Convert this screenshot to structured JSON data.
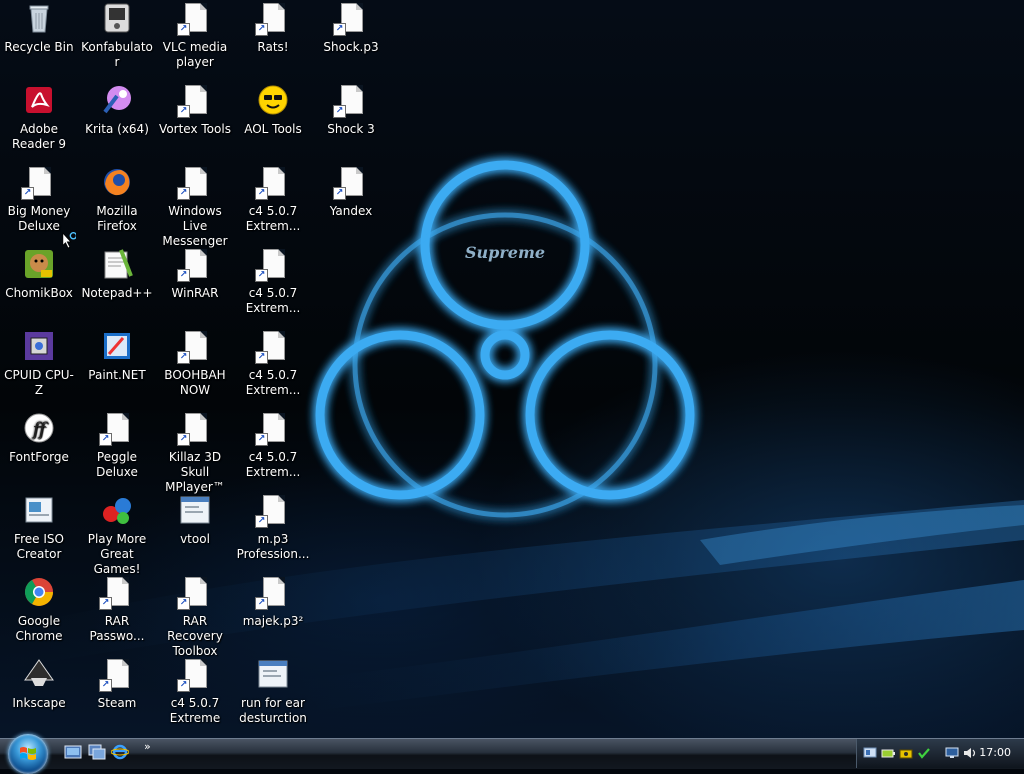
{
  "desktop": {
    "icons": [
      {
        "label": "Recycle Bin",
        "icon": "recycle-bin-icon"
      },
      {
        "label": "Adobe Reader 9",
        "icon": "adobe-reader-icon"
      },
      {
        "label": "Big Money Deluxe",
        "icon": "shortcut-document-icon"
      },
      {
        "label": "ChomikBox",
        "icon": "chomikbox-icon"
      },
      {
        "label": "CPUID CPU-Z",
        "icon": "cpuz-icon"
      },
      {
        "label": "FontForge",
        "icon": "fontforge-icon"
      },
      {
        "label": "Free ISO Creator",
        "icon": "iso-creator-icon"
      },
      {
        "label": "Google Chrome",
        "icon": "chrome-icon"
      },
      {
        "label": "Inkscape",
        "icon": "inkscape-icon"
      },
      {
        "label": "Konfabulator",
        "icon": "konfabulator-icon"
      },
      {
        "label": "Krita (x64)",
        "icon": "krita-icon"
      },
      {
        "label": "Mozilla Firefox",
        "icon": "firefox-icon"
      },
      {
        "label": "Notepad++",
        "icon": "notepadpp-icon"
      },
      {
        "label": "Paint.NET",
        "icon": "paintnet-icon"
      },
      {
        "label": "Peggle Deluxe",
        "icon": "shortcut-document-icon"
      },
      {
        "label": "Play More Great Games!",
        "icon": "games-icon"
      },
      {
        "label": "RAR Passwo...",
        "icon": "shortcut-document-icon"
      },
      {
        "label": "Steam",
        "icon": "shortcut-document-icon"
      },
      {
        "label": "VLC media player",
        "icon": "shortcut-document-icon"
      },
      {
        "label": "Vortex Tools",
        "icon": "shortcut-document-icon"
      },
      {
        "label": "Windows Live Messenger",
        "icon": "shortcut-document-icon"
      },
      {
        "label": "WinRAR",
        "icon": "shortcut-document-icon"
      },
      {
        "label": "BOOHBAH NOW",
        "icon": "shortcut-document-icon"
      },
      {
        "label": "Killaz 3D Skull MPlayer™",
        "icon": "shortcut-document-icon"
      },
      {
        "label": "vtool",
        "icon": "application-window-icon"
      },
      {
        "label": "RAR Recovery Toolbox",
        "icon": "shortcut-document-icon"
      },
      {
        "label": "c4 5.0.7 Extreme",
        "icon": "shortcut-document-icon"
      },
      {
        "label": "Rats!",
        "icon": "shortcut-document-icon"
      },
      {
        "label": "AOL Tools",
        "icon": "aol-smiley-icon"
      },
      {
        "label": "c4 5.0.7 Extrem...",
        "icon": "shortcut-document-icon"
      },
      {
        "label": "c4 5.0.7 Extrem...",
        "icon": "shortcut-document-icon"
      },
      {
        "label": "c4 5.0.7 Extrem...",
        "icon": "shortcut-document-icon"
      },
      {
        "label": "c4 5.0.7 Extrem...",
        "icon": "shortcut-document-icon"
      },
      {
        "label": "m.p3 Profession...",
        "icon": "shortcut-document-icon"
      },
      {
        "label": "majek.p3²",
        "icon": "shortcut-document-icon"
      },
      {
        "label": "run for ear desturction",
        "icon": "application-window-icon"
      },
      {
        "label": "Shock.p3",
        "icon": "shortcut-document-icon"
      },
      {
        "label": "Shock 3",
        "icon": "shortcut-document-icon"
      },
      {
        "label": "Yandex",
        "icon": "shortcut-document-icon"
      }
    ],
    "wallpaper_text": "Supreme",
    "colors": {
      "wallpaper_glow": "#2aa8ff",
      "taskbar": "#121820"
    }
  },
  "taskbar": {
    "start_button": "windows-start-orb",
    "quick_launch": [
      "show-desktop-icon",
      "switch-windows-icon",
      "internet-explorer-icon"
    ],
    "overflow": "»",
    "tray_icons": [
      "network-icon",
      "battery-icon",
      "safely-remove-icon",
      "security-check-icon",
      "monitor-icon",
      "volume-icon"
    ],
    "clock": "17:00"
  }
}
